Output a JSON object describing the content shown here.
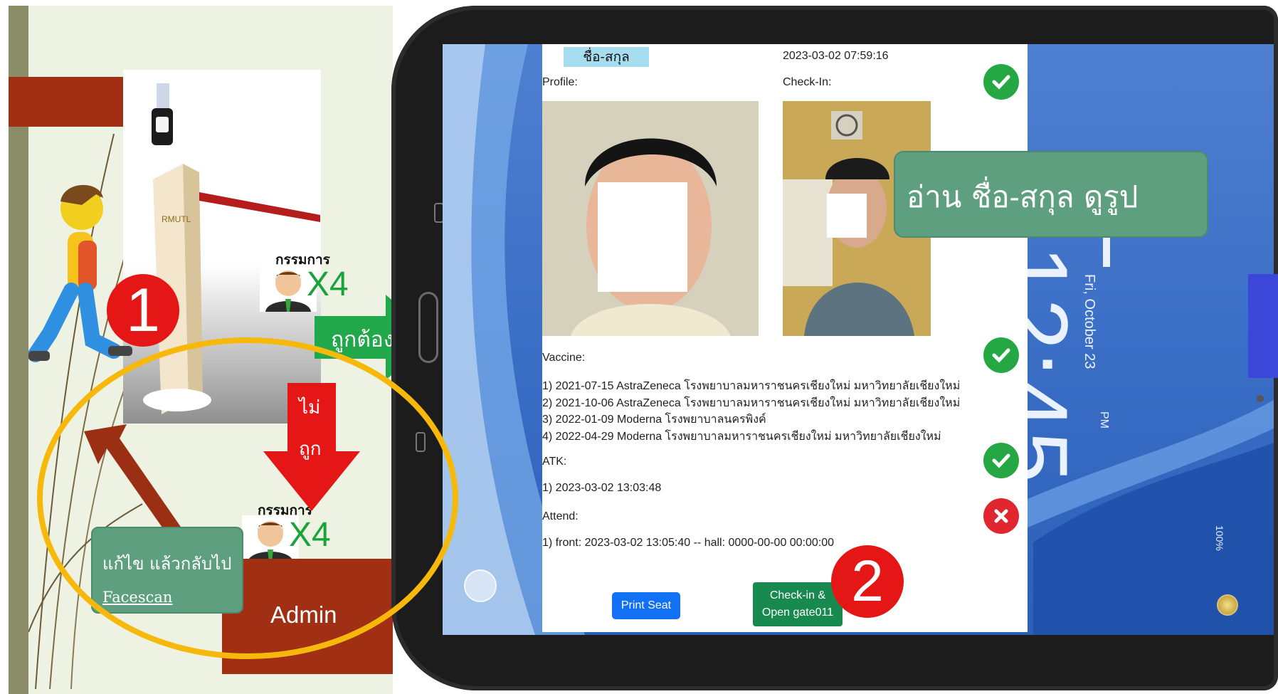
{
  "slide": {
    "step1": "1",
    "step2": "2",
    "committee_label": "กรรมการ",
    "committee_count": "X4",
    "correct_label": "ถูกต้อง",
    "wrong_label_1": "ไม่",
    "wrong_label_2": "ถูก",
    "fix_line_1": "แก้ไข แล้วกลับไป",
    "fix_line_2": "Facescan",
    "admin_label": "Admin",
    "gate_logo": "RMUTL"
  },
  "callout": {
    "text": "อ่าน ชื่อ-สกุล ดูรูป"
  },
  "lockscreen": {
    "clock": "12:45",
    "ampm": "PM",
    "date": "Fri, October 23",
    "battery": "100%"
  },
  "app": {
    "name_chip": "ชื่อ-สกุล",
    "datetime": "2023-03-02 07:59:16",
    "profile_label": "Profile:",
    "checkin_label": "Check-In:",
    "vaccine_label": "Vaccine:",
    "vaccines": [
      "1) 2021-07-15 AstraZeneca โรงพยาบาลมหาราชนครเชียงใหม่ มหาวิทยาลัยเชียงใหม่",
      "2) 2021-10-06 AstraZeneca โรงพยาบาลมหาราชนครเชียงใหม่ มหาวิทยาลัยเชียงใหม่",
      "3) 2022-01-09 Moderna โรงพยาบาลนครพิงค์",
      "4) 2022-04-29 Moderna โรงพยาบาลมหาราชนครเชียงใหม่ มหาวิทยาลัยเชียงใหม่"
    ],
    "atk_label": "ATK:",
    "atk_items": [
      "1) 2023-03-02 13:03:48"
    ],
    "attend_label": "Attend:",
    "attend_items": [
      "1) front: 2023-03-02 13:05:40 -- hall: 0000-00-00 00:00:00"
    ],
    "print_button": "Print Seat",
    "checkin_button_line1": "Check-in &",
    "checkin_button_line2": "Open gate011",
    "status": {
      "checkin": "ok",
      "vaccine": "ok",
      "atk": "ok",
      "attend": "fail"
    },
    "colors": {
      "ok": "#25a844",
      "fail": "#e0262e",
      "print": "#1170f4",
      "checkin": "#188a50",
      "chip": "#a6def0"
    }
  }
}
